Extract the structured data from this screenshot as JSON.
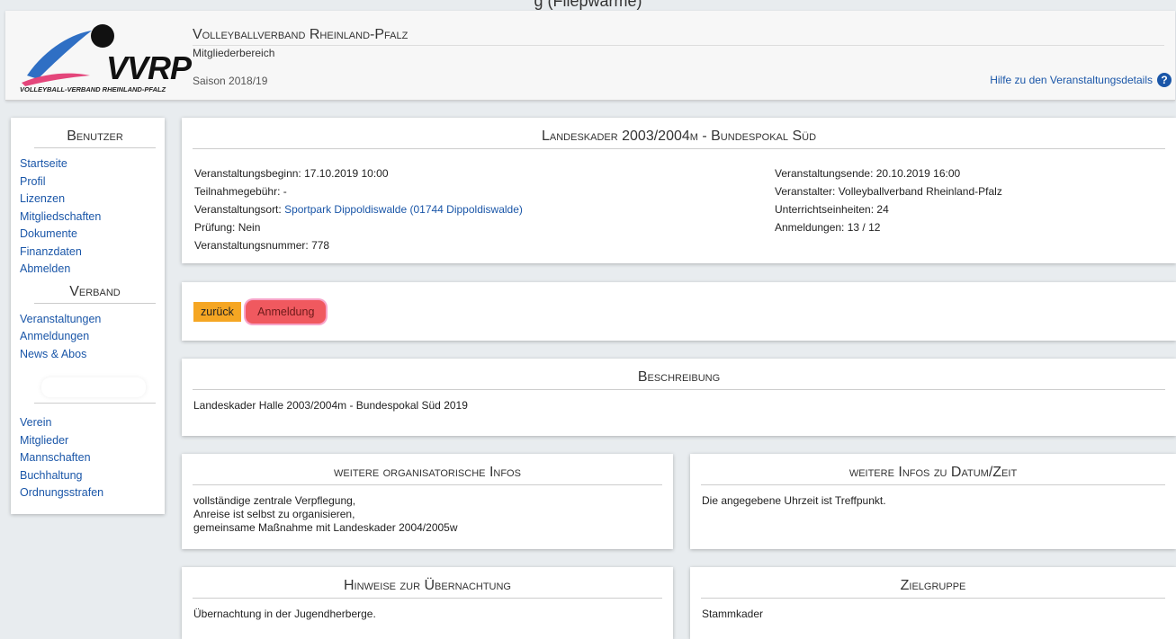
{
  "header": {
    "org_name": "Volleyballverband Rheinland-Pfalz",
    "subtitle": "Mitgliederbereich",
    "season": "Saison 2018/19",
    "help_link": "Hilfe zu den Veranstaltungsdetails",
    "logo_text": "VVRP",
    "logo_subtitle": "VOLLEYBALL-VERBAND RHEINLAND-PFALZ",
    "top_caption": "g (Fliepwarme)"
  },
  "sidebar": {
    "benutzer_heading": "Benutzer",
    "benutzer_links": [
      "Startseite",
      "Profil",
      "Lizenzen",
      "Mitgliedschaften",
      "Dokumente",
      "Finanzdaten",
      "Abmelden"
    ],
    "verband_heading": "Verband",
    "verband_links": [
      "Veranstaltungen",
      "Anmeldungen",
      "News & Abos"
    ],
    "verein_links": [
      "Verein",
      "Mitglieder",
      "Mannschaften",
      "Buchhaltung",
      "Ordnungsstrafen"
    ]
  },
  "event": {
    "title": "Landeskader 2003/2004m - Bundespokal Süd",
    "begin": "Veranstaltungsbeginn: 17.10.2019 10:00",
    "fee": "Teilnahmegebühr: -",
    "location_label": "Veranstaltungsort: ",
    "location_link": "Sportpark Dippoldiswalde (01744 Dippoldiswalde)",
    "exam": "Prüfung: Nein",
    "number": "Veranstaltungsnummer: 778",
    "end": "Veranstaltungsende: 20.10.2019 16:00",
    "organizer": "Veranstalter: Volleyballverband Rheinland-Pfalz",
    "units": "Unterrichtseinheiten: 24",
    "registrations": "Anmeldungen: 13 / 12"
  },
  "actions": {
    "back_label": "zurück",
    "register_label": "Anmeldung"
  },
  "description": {
    "title": "Beschreibung",
    "text": "Landeskader Halle 2003/2004m - Bundespokal Süd 2019"
  },
  "org_info": {
    "title": "weitere organisatorische Infos",
    "lines": [
      "vollständige zentrale Verpflegung,",
      "Anreise ist selbst zu organisieren,",
      "gemeinsame Maßnahme mit Landeskader 2004/2005w"
    ]
  },
  "date_info": {
    "title": "weitere Infos zu Datum/Zeit",
    "text": "Die angegebene Uhrzeit ist Treffpunkt."
  },
  "overnight": {
    "title": "Hinweise zur Übernachtung",
    "text": "Übernachtung in der Jugendherberge."
  },
  "target_group": {
    "title": "Zielgruppe",
    "text": "Stammkader"
  }
}
